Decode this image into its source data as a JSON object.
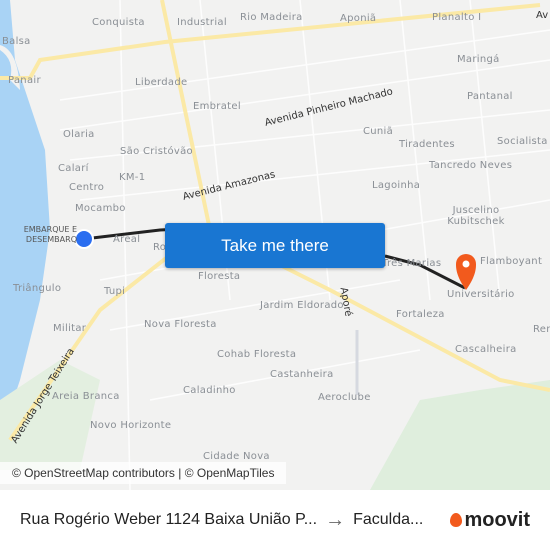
{
  "map": {
    "neighborhoods": [
      "Conquista",
      "Industrial",
      "Rio Madeira",
      "Aponiã",
      "Planalto I",
      "Balsa",
      "Panair",
      "Liberdade",
      "Maringá",
      "Embratel",
      "Pantanal",
      "Olaria",
      "Cuniã",
      "Tiradentes",
      "Socialista",
      "São Cristóvão",
      "Tancredo Neves",
      "Calarí",
      "KM-1",
      "Centro",
      "Lagoinha",
      "Mocambo",
      "Juscelino Kubitschek",
      "Areal",
      "Três Marias",
      "Flamboyant",
      "Triângulo",
      "Tupi",
      "Floresta",
      "Universitário",
      "Jardim Eldorado",
      "Fortaleza",
      "Militar",
      "Nova Floresta",
      "Cascalheira",
      "Cohab Floresta",
      "Castanheira",
      "Caladinho",
      "Aeroclube",
      "Areia Branca",
      "Novo Horizonte",
      "Cidade Nova",
      "Ren",
      "Ro"
    ],
    "roads": [
      "Avenida Pinheiro Machado",
      "Avenida Amazonas",
      "Avenida Jorge Teixeira",
      "Av",
      "Aporé"
    ],
    "origin_stop": "EMBARQUE E DESEMBARQ",
    "route_color": "#222222",
    "origin_color": "#2b6ef0",
    "destination_color": "#f25a1d",
    "attribution": "© OpenStreetMap contributors | © OpenMapTiles"
  },
  "cta": {
    "label": "Take me there"
  },
  "footer": {
    "origin": "Rua Rogério Weber 1124 Baixa União P...",
    "destination": "Faculda...",
    "brand": "moovit"
  }
}
